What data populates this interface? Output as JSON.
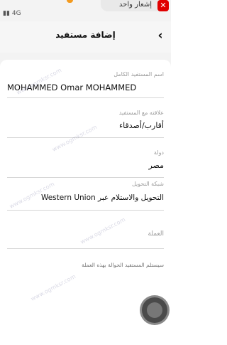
{
  "status_bar": {
    "left_text": "4G",
    "notification_text": "إشعار واحد",
    "close_glyph": "✕"
  },
  "header": {
    "title": "إضافة مستفيد",
    "back_glyph": "‹"
  },
  "form": {
    "name_label": "اسم المستفيد الكامل",
    "name_value": "MOHAMMED Omar MOHAMMED",
    "relationship_label": "علاقته مع المستفيد",
    "relationship_value": "أقارب/أصدقاء",
    "country_label": "دولة",
    "country_value": "مصر",
    "method_label": "شبكة التحويل",
    "method_value": "التحويل والاستلام عبر Western Union",
    "currency_label": "العملة",
    "hint_text": "سيستلم المستفيد الحوالة بهذه العملة"
  },
  "watermark": "www.ogmksr.com"
}
